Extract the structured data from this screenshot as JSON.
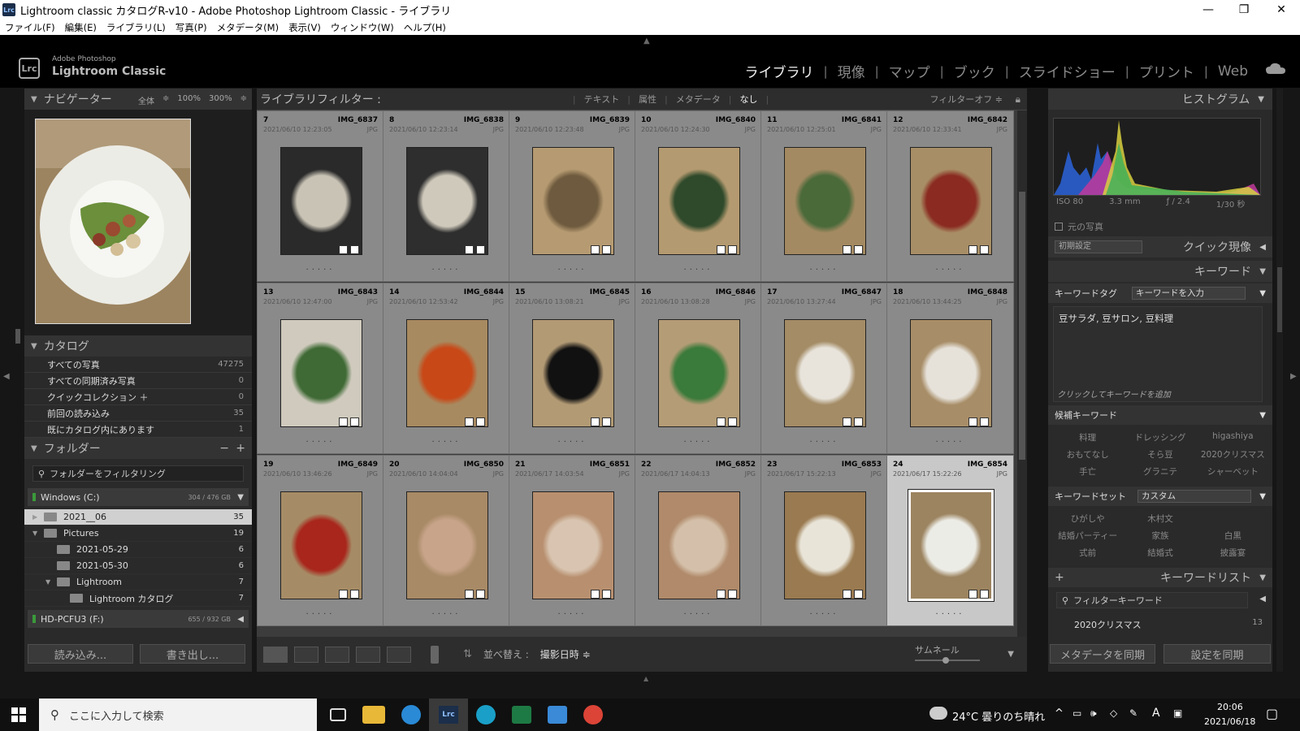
{
  "window": {
    "title": "Lightroom classic カタログR-v10 - Adobe Photoshop Lightroom Classic - ライブラリ",
    "app_icon": "Lrc",
    "controls": {
      "minimize": "—",
      "maximize": "❐",
      "close": "✕"
    }
  },
  "menubar": [
    "ファイル(F)",
    "編集(E)",
    "ライブラリ(L)",
    "写真(P)",
    "メタデータ(M)",
    "表示(V)",
    "ウィンドウ(W)",
    "ヘルプ(H)"
  ],
  "identity": {
    "logo": "Lrc",
    "sub": "Adobe Photoshop",
    "main": "Lightroom Classic"
  },
  "modules": [
    "ライブラリ",
    "現像",
    "マップ",
    "ブック",
    "スライドショー",
    "プリント",
    "Web"
  ],
  "left": {
    "navigator": {
      "title": "ナビゲーター",
      "opts": [
        "全体",
        "100%",
        "300%"
      ]
    },
    "catalog": {
      "title": "カタログ",
      "items": [
        {
          "label": "すべての写真",
          "count": "47275"
        },
        {
          "label": "すべての同期済み写真",
          "count": "0"
        },
        {
          "label": "クイックコレクション ＋",
          "count": "0"
        },
        {
          "label": "前回の読み込み",
          "count": "35"
        },
        {
          "label": "既にカタログ内にあります",
          "count": "1"
        }
      ]
    },
    "folders": {
      "title": "フォルダー",
      "filter_placeholder": "フォルダーをフィルタリング",
      "volume1": {
        "name": "Windows (C:)",
        "cap": "304 / 476 GB"
      },
      "items": [
        {
          "label": "2021__06",
          "count": "35",
          "indent": 0,
          "tri": "▶"
        },
        {
          "label": "Pictures",
          "count": "19",
          "indent": 0,
          "tri": "▼"
        },
        {
          "label": "2021-05-29",
          "count": "6",
          "indent": 1,
          "tri": ""
        },
        {
          "label": "2021-05-30",
          "count": "6",
          "indent": 1,
          "tri": ""
        },
        {
          "label": "Lightroom",
          "count": "7",
          "indent": 1,
          "tri": "▼"
        },
        {
          "label": "Lightroom カタログ",
          "count": "7",
          "indent": 2,
          "tri": ""
        }
      ],
      "volume2": {
        "name": "HD-PCFU3 (F:)",
        "cap": "655 / 932 GB"
      }
    },
    "import_btn": "読み込み...",
    "export_btn": "書き出し..."
  },
  "center": {
    "filter": {
      "label": "ライブラリフィルター :",
      "tabs": [
        "テキスト",
        "属性",
        "メタデータ",
        "なし"
      ],
      "off": "フィルターオフ ≑"
    },
    "cells": [
      {
        "num": "7",
        "name": "IMG_6837",
        "date": "2021/06/10 12:23:05",
        "ext": "JPG",
        "c1": "#2a2a2a",
        "c2": "#c9c3b5"
      },
      {
        "num": "8",
        "name": "IMG_6838",
        "date": "2021/06/10 12:23:14",
        "ext": "JPG",
        "c1": "#2e2e2e",
        "c2": "#cfc9bb"
      },
      {
        "num": "9",
        "name": "IMG_6839",
        "date": "2021/06/10 12:23:48",
        "ext": "JPG",
        "c1": "#b69b72",
        "c2": "#6e5a3e"
      },
      {
        "num": "10",
        "name": "IMG_6840",
        "date": "2021/06/10 12:24:30",
        "ext": "JPG",
        "c1": "#b49a70",
        "c2": "#2f4a2b"
      },
      {
        "num": "11",
        "name": "IMG_6841",
        "date": "2021/06/10 12:25:01",
        "ext": "JPG",
        "c1": "#a48a62",
        "c2": "#4a6a3a"
      },
      {
        "num": "12",
        "name": "IMG_6842",
        "date": "2021/06/10 12:33:41",
        "ext": "JPG",
        "c1": "#a88e66",
        "c2": "#8a2a20"
      },
      {
        "num": "13",
        "name": "IMG_6843",
        "date": "2021/06/10 12:47:00",
        "ext": "JPG",
        "c1": "#cfcabd",
        "c2": "#3f6a35"
      },
      {
        "num": "14",
        "name": "IMG_6844",
        "date": "2021/06/10 12:53:42",
        "ext": "JPG",
        "c1": "#a88a60",
        "c2": "#c84818"
      },
      {
        "num": "15",
        "name": "IMG_6845",
        "date": "2021/06/10 13:08:21",
        "ext": "JPG",
        "c1": "#b29a74",
        "c2": "#111111"
      },
      {
        "num": "16",
        "name": "IMG_6846",
        "date": "2021/06/10 13:08:28",
        "ext": "JPG",
        "c1": "#b49c76",
        "c2": "#3a7a3a"
      },
      {
        "num": "17",
        "name": "IMG_6847",
        "date": "2021/06/10 13:27:44",
        "ext": "JPG",
        "c1": "#a48c66",
        "c2": "#e8e4dc"
      },
      {
        "num": "18",
        "name": "IMG_6848",
        "date": "2021/06/10 13:44:25",
        "ext": "JPG",
        "c1": "#a88e68",
        "c2": "#e6e2da"
      },
      {
        "num": "19",
        "name": "IMG_6849",
        "date": "2021/06/10 13:46:26",
        "ext": "JPG",
        "c1": "#a68c66",
        "c2": "#a8261c"
      },
      {
        "num": "20",
        "name": "IMG_6850",
        "date": "2021/06/10 14:04:04",
        "ext": "JPG",
        "c1": "#a88a66",
        "c2": "#c8a48a"
      },
      {
        "num": "21",
        "name": "IMG_6851",
        "date": "2021/06/17 14:03:54",
        "ext": "JPG",
        "c1": "#b89070",
        "c2": "#d8c4b0"
      },
      {
        "num": "22",
        "name": "IMG_6852",
        "date": "2021/06/17 14:04:13",
        "ext": "JPG",
        "c1": "#b08a6a",
        "c2": "#d4c0aa"
      },
      {
        "num": "23",
        "name": "IMG_6853",
        "date": "2021/06/17 15:22:13",
        "ext": "JPG",
        "c1": "#9a7a50",
        "c2": "#e8e4d8"
      },
      {
        "num": "24",
        "name": "IMG_6854",
        "date": "2021/06/17 15:22:26",
        "ext": "JPG",
        "c1": "#9c8460",
        "c2": "#ecece6"
      }
    ],
    "toolbar": {
      "sort_label": "並べ替え :",
      "sort_value": "撮影日時 ≑",
      "thumb_label": "サムネール"
    }
  },
  "right": {
    "histogram": {
      "title": "ヒストグラム",
      "iso": "ISO 80",
      "focal": "3.3 mm",
      "fstop": "ƒ / 2.4",
      "shutter": "1/30 秒",
      "original": "元の写真"
    },
    "quick": {
      "preset": "初期設定",
      "title": "クイック現像"
    },
    "keyword": {
      "title": "キーワード",
      "tag_label": "キーワードタグ",
      "tag_value": "キーワードを入力",
      "text": "豆サラダ, 豆サロン, 豆料理",
      "hint": "クリックしてキーワードを追加"
    },
    "suggest": {
      "title": "候補キーワード",
      "items": [
        "料理",
        "ドレッシング",
        "higashiya",
        "おもてなし",
        "そら豆",
        "2020クリスマス",
        "手亡",
        "グラニテ",
        "シャーベット"
      ]
    },
    "kwset": {
      "label": "キーワードセット",
      "value": "カスタム",
      "items": [
        "ひがしや",
        "木村文",
        "",
        "結婚パーティー",
        "家族",
        "白黒",
        "式前",
        "結婚式",
        "披露宴"
      ]
    },
    "kwlist": {
      "title": "キーワードリスト",
      "filter": "フィルターキーワード",
      "first": "2020クリスマス",
      "first_count": "13"
    },
    "sync_meta": "メタデータを同期",
    "sync_settings": "設定を同期"
  },
  "taskbar": {
    "search": "ここに入力して検索",
    "weather": "24°C  曇りのち晴れ",
    "ime": "A",
    "time": "20:06",
    "date": "2021/06/18"
  }
}
